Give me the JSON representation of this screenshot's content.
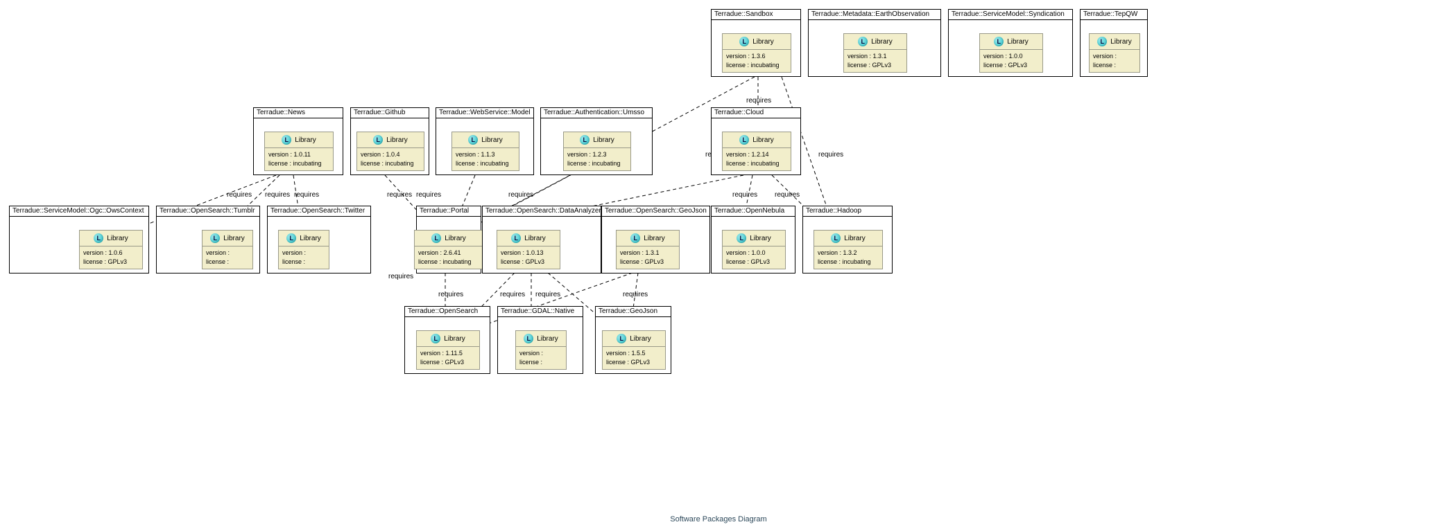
{
  "caption": "Software Packages Diagram",
  "library_label": "Library",
  "version_prefix": "version : ",
  "license_prefix": "license : ",
  "packages": {
    "sandbox": {
      "name": "Terradue::Sandbox",
      "version": "1.3.6",
      "license": "incubating"
    },
    "metadata": {
      "name": "Terradue::Metadata::EarthObservation",
      "version": "1.3.1",
      "license": "GPLv3"
    },
    "syndication": {
      "name": "Terradue::ServiceModel::Syndication",
      "version": "1.0.0",
      "license": "GPLv3"
    },
    "tepqw": {
      "name": "Terradue::TepQW",
      "version": "",
      "license": ""
    },
    "news": {
      "name": "Terradue::News",
      "version": "1.0.11",
      "license": "incubating"
    },
    "github": {
      "name": "Terradue::Github",
      "version": "1.0.4",
      "license": "incubating"
    },
    "webservice": {
      "name": "Terradue::WebService::Model",
      "version": "1.1.3",
      "license": "incubating"
    },
    "umsso": {
      "name": "Terradue::Authentication::Umsso",
      "version": "1.2.3",
      "license": "incubating"
    },
    "cloud": {
      "name": "Terradue::Cloud",
      "version": "1.2.14",
      "license": "incubating"
    },
    "owscontext": {
      "name": "Terradue::ServiceModel::Ogc::OwsContext",
      "version": "1.0.6",
      "license": "GPLv3"
    },
    "tumblr": {
      "name": "Terradue::OpenSearch::Tumblr",
      "version": "",
      "license": ""
    },
    "twitter": {
      "name": "Terradue::OpenSearch::Twitter",
      "version": "",
      "license": ""
    },
    "portal": {
      "name": "Terradue::Portal",
      "version": "2.6.41",
      "license": "incubating"
    },
    "dataanalyzer": {
      "name": "Terradue::OpenSearch::DataAnalyzer",
      "version": "1.0.13",
      "license": "GPLv3"
    },
    "osgeojson": {
      "name": "Terradue::OpenSearch::GeoJson",
      "version": "1.3.1",
      "license": "GPLv3"
    },
    "opennebula": {
      "name": "Terradue::OpenNebula",
      "version": "1.0.0",
      "license": "GPLv3"
    },
    "hadoop": {
      "name": "Terradue::Hadoop",
      "version": "1.3.2",
      "license": "incubating"
    },
    "opensearch": {
      "name": "Terradue::OpenSearch",
      "version": "1.11.5",
      "license": "GPLv3"
    },
    "gdalnative": {
      "name": "Terradue::GDAL::Native",
      "version": "",
      "license": ""
    },
    "geojson": {
      "name": "Terradue::GeoJson",
      "version": "1.5.5",
      "license": "GPLv3"
    }
  },
  "requires_label": "requires",
  "dependencies": [
    {
      "from": "sandbox",
      "to": "portal"
    },
    {
      "from": "sandbox",
      "to": "cloud"
    },
    {
      "from": "sandbox",
      "to": "hadoop"
    },
    {
      "from": "news",
      "to": "owscontext"
    },
    {
      "from": "news",
      "to": "tumblr"
    },
    {
      "from": "news",
      "to": "twitter"
    },
    {
      "from": "github",
      "to": "portal"
    },
    {
      "from": "webservice",
      "to": "portal"
    },
    {
      "from": "umsso",
      "to": "portal"
    },
    {
      "from": "cloud",
      "to": "portal"
    },
    {
      "from": "cloud",
      "to": "opennebula"
    },
    {
      "from": "cloud",
      "to": "hadoop"
    },
    {
      "from": "portal",
      "to": "opensearch"
    },
    {
      "from": "dataanalyzer",
      "to": "opensearch"
    },
    {
      "from": "dataanalyzer",
      "to": "gdalnative"
    },
    {
      "from": "dataanalyzer",
      "to": "geojson"
    },
    {
      "from": "osgeojson",
      "to": "opensearch"
    },
    {
      "from": "osgeojson",
      "to": "geojson"
    }
  ]
}
